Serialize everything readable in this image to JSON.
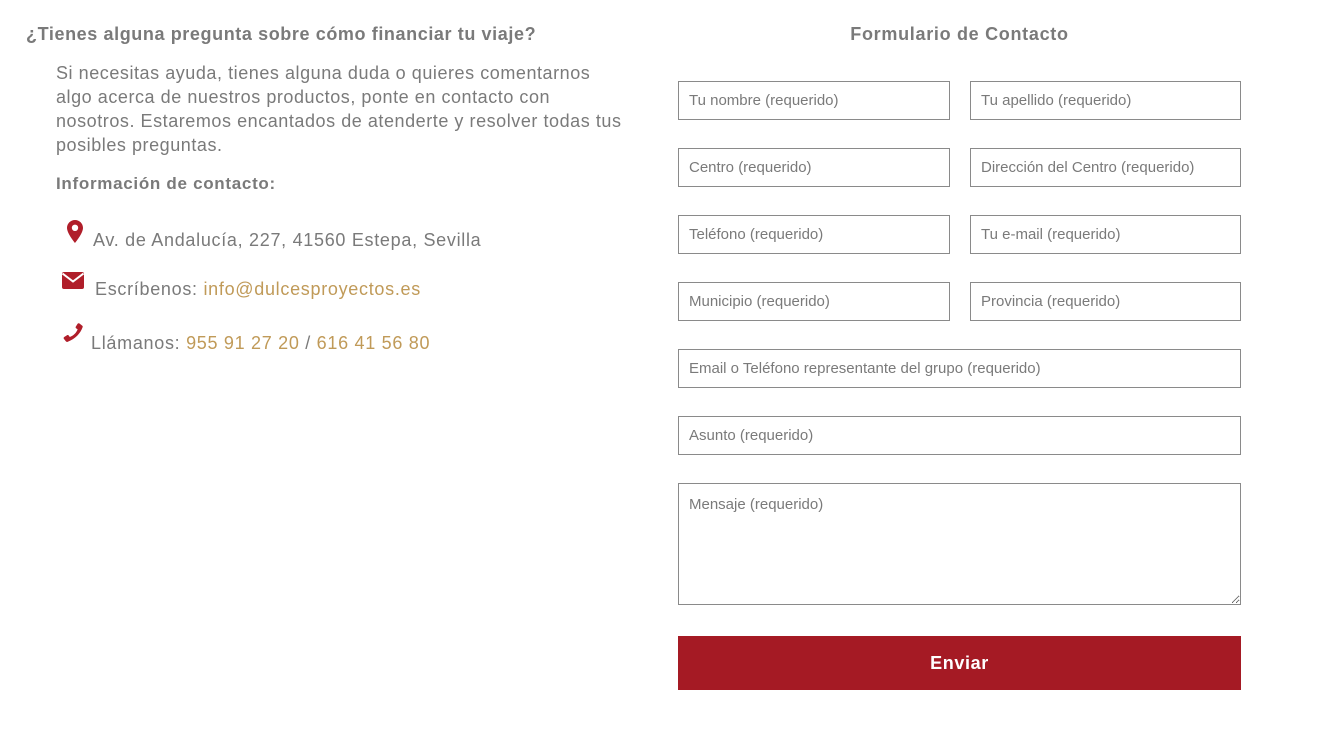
{
  "info": {
    "question": "¿Tienes alguna pregunta sobre cómo financiar tu viaje?",
    "intro": "Si necesitas ayuda, tienes alguna duda o quieres comentarnos algo acerca de nuestros productos, ponte en contacto con nosotros. Estaremos encantados de atenderte y resolver todas tus posibles preguntas.",
    "contact_heading": "Información de contacto:",
    "address": "Av. de Andalucía, 227, 41560 Estepa, Sevilla",
    "email_label": "Escríbenos: ",
    "email": "info@dulcesproyectos.es",
    "phone_label": "Llámanos: ",
    "phone1": "955 91 27 20",
    "phone_separator": " / ",
    "phone2": "616 41 56 80",
    "icons": {
      "address": "map-marker-icon",
      "email": "envelope-icon",
      "phone": "phone-icon"
    }
  },
  "form": {
    "title": "Formulario de Contacto",
    "fields": {
      "first_name": "Tu nombre (requerido)",
      "last_name": "Tu apellido (requerido)",
      "center": "Centro (requerido)",
      "center_address": "Dirección del Centro (requerido)",
      "phone": "Teléfono (requerido)",
      "email": "Tu e-mail (requerido)",
      "municipality": "Municipio (requerido)",
      "province": "Provincia (requerido)",
      "representative": "Email o Teléfono representante del grupo (requerido)",
      "subject": "Asunto (requerido)",
      "message": "Mensaje (requerido)"
    },
    "submit_label": "Enviar"
  },
  "colors": {
    "accent": "#a51a24",
    "link": "#c09a58",
    "text": "#7a7a7a",
    "border": "#8a8a8a"
  }
}
